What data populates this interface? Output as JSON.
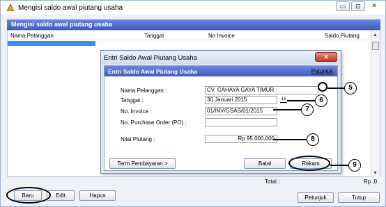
{
  "window": {
    "title": "Mengisi saldo awal piutang usaha",
    "min_label": "▭",
    "max_label": "⊡",
    "close_label": "✕"
  },
  "main": {
    "header": "Mengisi saldo awal piutang usaha",
    "columns": [
      "Nama Pelanggan",
      "Tanggal",
      "No Invoice",
      "Saldo Piutang"
    ],
    "total_label": "Total :",
    "total_value": "Rp ,0"
  },
  "buttons": {
    "baru": "Baru",
    "edit": "Edit",
    "hapus": "Hapus",
    "petunjuk": "Petunjuk",
    "tutup": "Tutup"
  },
  "dialog": {
    "title": "Entri Saldo Awal Piutang Usaha",
    "close_label": "✕",
    "header": "Entri Saldo Awal Piutang Usaha",
    "help": "Petunjuk",
    "labels": {
      "nama": "Nama Pelanggan :",
      "tanggal": "Tanggal :",
      "invoice": "No. Invoice :",
      "po": "No. Purchase Order (PO) :",
      "nilai": "Nilai Piutang :"
    },
    "values": {
      "nama": "CV. CAHAYA GAYA TIMUR",
      "tanggal": "30 Januari 2015",
      "invoice": "01/INV/GSAS/01/2015",
      "po": "",
      "nilai": "Rp 95.000.000"
    },
    "calendar_label": "15",
    "term_button": "Term Pembayaran >",
    "batal_button": "Batal",
    "rekam_button": "Rekam"
  },
  "annotations": [
    "5",
    "6",
    "7",
    "8",
    "9"
  ]
}
